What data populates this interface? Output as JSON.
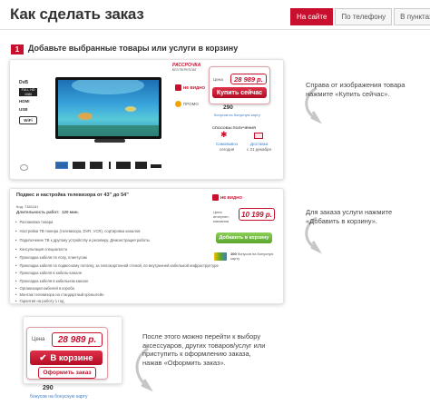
{
  "page": {
    "title": "Как сделать заказ"
  },
  "tabs": [
    "На сайте",
    "По телефону",
    "В пунктах выдачи"
  ],
  "step1": {
    "number": "1",
    "title": "Добавьте выбранные товары или услуги в корзину"
  },
  "card1": {
    "spec_badges": [
      "DvB",
      "FULL HD 1080",
      "HDMI",
      "USB",
      "WiFi"
    ],
    "installment_label": "РАССРОЧКА",
    "installment_sub": "БЕЗ ПЕРЕПЛАТ",
    "side_badges": [
      "НЕ ВИДНО",
      "ПРОМО"
    ],
    "price_label": "Цена",
    "price": "28 989 р.",
    "buy_button": "Купить сейчас",
    "bonus_value": "290",
    "bonus_text": "бонусов на бонусную карту",
    "delivery_header": "СПОСОБЫ ПОЛУЧЕНИЯ",
    "pickup_label": "Самовывоз",
    "pickup_sub": "сегодня",
    "delivery_label": "Доставка",
    "delivery_sub": "с 21 декабря",
    "colors": {
      "accent": "#c8102e",
      "green": "#5aa52c"
    }
  },
  "hint1": "Справа от изображения товара нажмите «Купить сейчас».",
  "card2": {
    "title": "Подвес и настройка телевизора от 43\" до 54\"",
    "code": "Код: 7381161",
    "duration_label": "Длительность работ:",
    "duration_value": "120 мин.",
    "features": [
      "Распаковка товара",
      "Настройка ТВ-тюнера (телевизора, DVR, VCR), сортировка каналов",
      "Подключение ТВ к другому устройству и ресиверу. Демонстрация работы",
      "Консультация специалиста",
      "Прокладка кабеля по полу, плинтусам",
      "Прокладка кабеля по подвесному потолку, за гипсокартонной стеной, по внутренней кабельной инфраструктуре",
      "Прокладка кабеля в кабель-канале",
      "Прокладка кабеля в кабельном канале",
      "Организация кабелей в короба",
      "Монтаж телевизора на стандартный кронштейн",
      "Гарантия на работу 1 год"
    ],
    "internet_badge": "НЕ ВИДНО",
    "internet_label": "Цена интернет-магазина",
    "price": "10 199 р.",
    "add_button": "Добавить в корзину",
    "bonus_value": "100",
    "bonus_text": "бонусов на бонусную карту"
  },
  "hint2": "Для заказа услуги нажмите «Добавить в корзину».",
  "card3": {
    "price_label": "Цена",
    "price": "28 989 р.",
    "in_cart_button": "В корзине",
    "checkout_button": "Оформить заказ",
    "bonus_value": "290",
    "bonus_text": "бонусов на бонусную карту"
  },
  "hint3": "После этого можно перейти к выбору аксессуаров, других товаров/услуг или приступить к оформлению заказа, нажав «Оформить заказ»."
}
